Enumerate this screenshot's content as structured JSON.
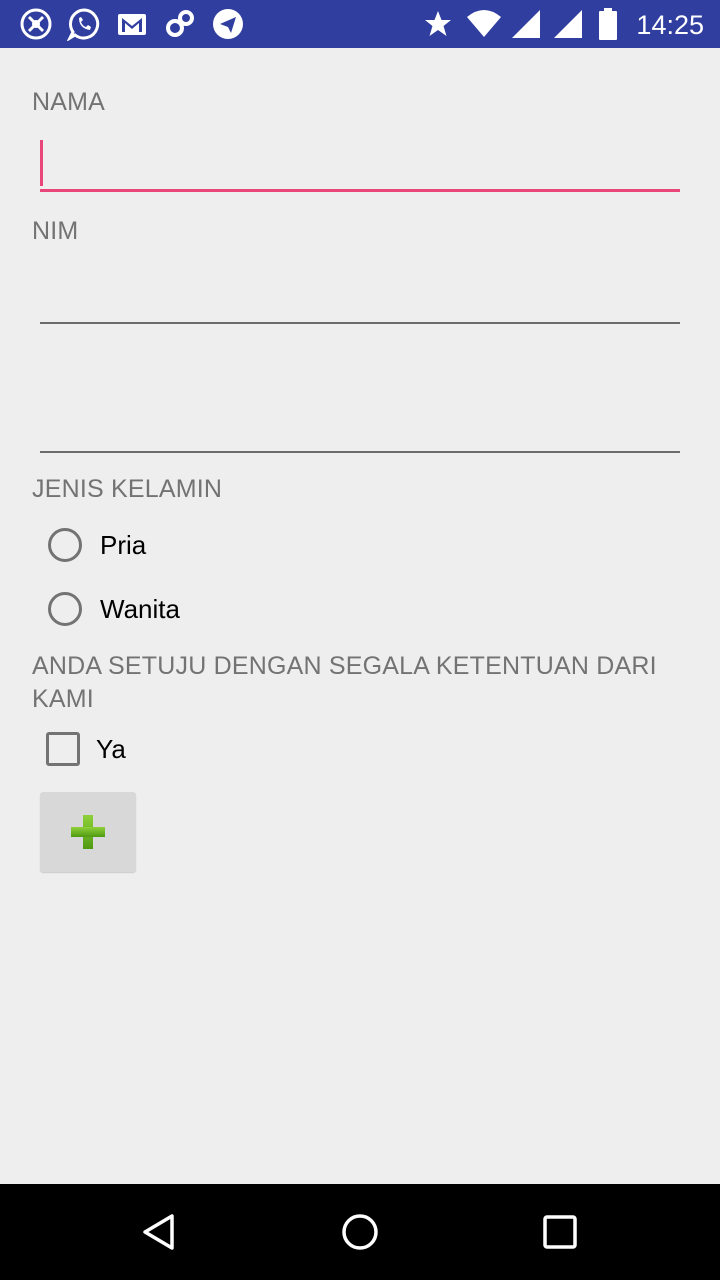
{
  "status_bar": {
    "left_icons": [
      "app-notification-icon",
      "whatsapp-icon",
      "gmail-icon",
      "link-app-icon",
      "telegram-icon"
    ],
    "right_icons": [
      "star-icon",
      "wifi-icon",
      "signal-icon",
      "signal-icon",
      "battery-icon"
    ],
    "time": "14:25",
    "background": "#303f9f"
  },
  "form": {
    "nama_label": "NAMA",
    "nama_value": "",
    "nim_label": "NIM",
    "nim_value": "",
    "extra_value": "",
    "gender_label": "JENIS KELAMIN",
    "gender_options": [
      "Pria",
      "Wanita"
    ],
    "terms_label": "ANDA SETUJU DENGAN SEGALA KETENTUAN DARI KAMI",
    "terms_checkbox_label": "Ya",
    "add_button_icon": "plus-icon",
    "accent_color": "#e8457a",
    "plus_color": "#6cb01e"
  },
  "nav_bar": {
    "icons": [
      "back-icon",
      "home-icon",
      "recents-icon"
    ]
  }
}
